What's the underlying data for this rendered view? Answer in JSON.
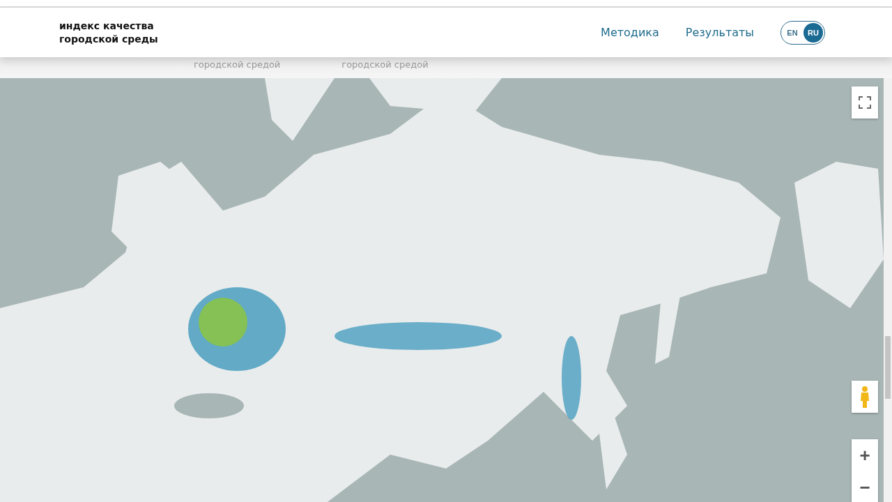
{
  "header": {
    "logo": [
      "индекс качества",
      "городской среды"
    ],
    "nav": [
      {
        "label": "Методика"
      },
      {
        "label": "Результаты"
      }
    ],
    "languages": [
      {
        "label": "EN",
        "selected": false
      },
      {
        "label": "RU",
        "selected": true
      }
    ]
  },
  "behind_header": [
    "городской средой",
    "городской средой"
  ],
  "map": {
    "kind": "picture",
    "zoom_in": "+",
    "zoom_out": "−"
  }
}
